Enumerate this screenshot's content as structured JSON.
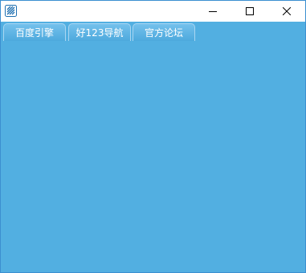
{
  "window": {
    "title": "",
    "controls": {
      "minimize_icon": "minimize-icon",
      "maximize_icon": "maximize-icon",
      "close_icon": "close-icon"
    }
  },
  "tabs": [
    {
      "label": "百度引擎"
    },
    {
      "label": "好123导航"
    },
    {
      "label": "官方论坛"
    }
  ],
  "colors": {
    "client_background": "#52afe1",
    "window_border": "#3c8fd0",
    "tab_text": "#ffffff"
  }
}
